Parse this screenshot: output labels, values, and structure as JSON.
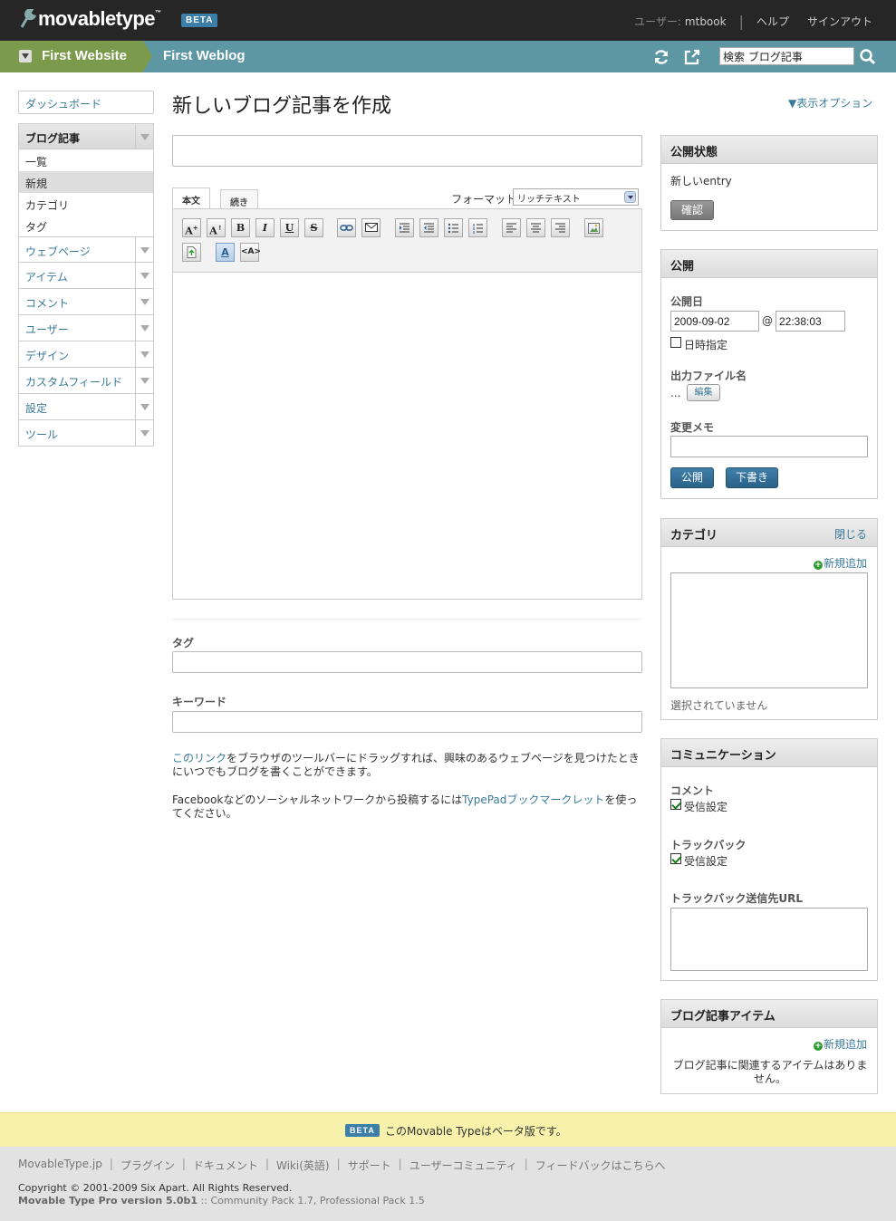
{
  "header": {
    "logo_text": "movabletype",
    "logo_tm": "™",
    "beta_badge": "BETA",
    "user_label": "ユーザー:",
    "user_name": "mtbook",
    "help": "ヘルプ",
    "signout": "サインアウト"
  },
  "sitebar": {
    "website": "First Website",
    "blog": "First Weblog",
    "search_value": "検索 ブログ記事"
  },
  "sidebar": {
    "dashboard": "ダッシュボード",
    "entries_label": "ブログ記事",
    "entries_sub": [
      "一覧",
      "新規",
      "カテゴリ",
      "タグ"
    ],
    "items": [
      "ウェブページ",
      "アイテム",
      "コメント",
      "ユーザー",
      "デザイン",
      "カスタムフィールド",
      "設定",
      "ツール"
    ]
  },
  "main": {
    "title": "新しいブログ記事を作成",
    "display_options": "▼表示オプション",
    "tab_body": "本文",
    "tab_more": "続き",
    "format_label": "フォーマット:",
    "format_value": "リッチテキスト",
    "tags_label": "タグ",
    "keywords_label": "キーワード",
    "help1_link": "このリンク",
    "help1_text": "をブラウザのツールバーにドラッグすれば、興味のあるウェブページを見つけたときにいつでもブログを書くことができます。",
    "help2_pre": "Facebookなどのソーシャルネットワークから投稿するには",
    "help2_link": "TypePadブックマークレット",
    "help2_post": "を使ってください。"
  },
  "widgets": {
    "status": {
      "title": "公開状態",
      "value": "新しいentry",
      "button": "確認"
    },
    "publish": {
      "title": "公開",
      "date_label": "公開日",
      "date_value": "2009-09-02",
      "at": "@",
      "time_value": "22:38:03",
      "schedule_label": "日時指定",
      "filename_label": "出力ファイル名",
      "filename_value": "...",
      "edit_button": "編集",
      "memo_label": "変更メモ",
      "publish_button": "公開",
      "draft_button": "下書き"
    },
    "category": {
      "title": "カテゴリ",
      "close": "閉じる",
      "add": "新規追加",
      "none": "選択されていません"
    },
    "communication": {
      "title": "コミュニケーション",
      "comments_label": "コメント",
      "comments_accept": "受信設定",
      "tb_label": "トラックバック",
      "tb_accept": "受信設定",
      "tb_url_label": "トラックバック送信先URL"
    },
    "assets": {
      "title": "ブログ記事アイテム",
      "add": "新規追加",
      "none": "ブログ記事に関連するアイテムはありません。"
    }
  },
  "footer": {
    "beta_badge": "BETA",
    "beta_text": "このMovable Typeはベータ版です。",
    "links": [
      "MovableType.jp",
      "プラグイン",
      "ドキュメント",
      "Wiki(英語)",
      "サポート",
      "ユーザーコミュニティ",
      "フィードバックはこちらへ"
    ],
    "copyright": "Copyright © 2001-2009 Six Apart. All Rights Reserved.",
    "version_bold": "Movable Type Pro version 5.0b1",
    "version_rest": " :: Community Pack 1.7, Professional Pack 1.5"
  },
  "toolbar_icons": [
    "font-size-increase-icon",
    "font-size-decrease-icon",
    "bold-icon",
    "italic-icon",
    "underline-icon",
    "strikethrough-icon",
    "link-icon",
    "email-icon",
    "indent-icon",
    "outdent-icon",
    "unordered-list-icon",
    "ordered-list-icon",
    "align-left-icon",
    "align-center-icon",
    "align-right-icon",
    "insert-image-icon",
    "insert-file-icon",
    "text-color-icon",
    "html-mode-icon"
  ],
  "colors": {
    "topbar": "#262626",
    "website_bar": "#7c9a4c",
    "blog_bar": "#5e97a4",
    "link": "#3a7a99",
    "primary_button": "#2b6289",
    "beta_banner": "#f7f1ab"
  }
}
